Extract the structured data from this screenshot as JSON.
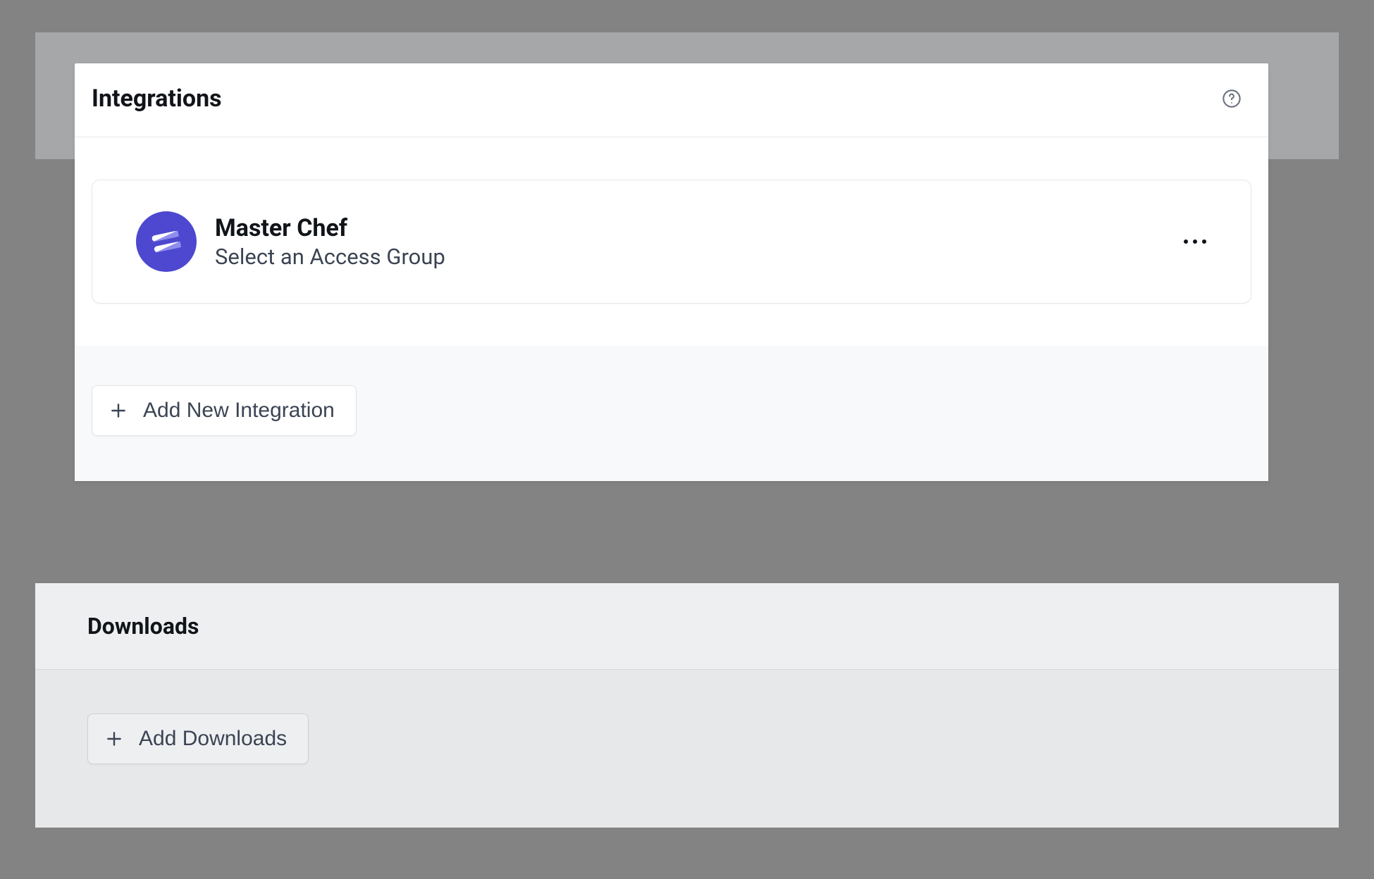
{
  "integrations": {
    "title": "Integrations",
    "items": [
      {
        "name": "Master Chef",
        "subtitle": "Select an Access Group"
      }
    ],
    "add_button_label": "Add New Integration"
  },
  "downloads": {
    "title": "Downloads",
    "add_button_label": "Add Downloads"
  }
}
